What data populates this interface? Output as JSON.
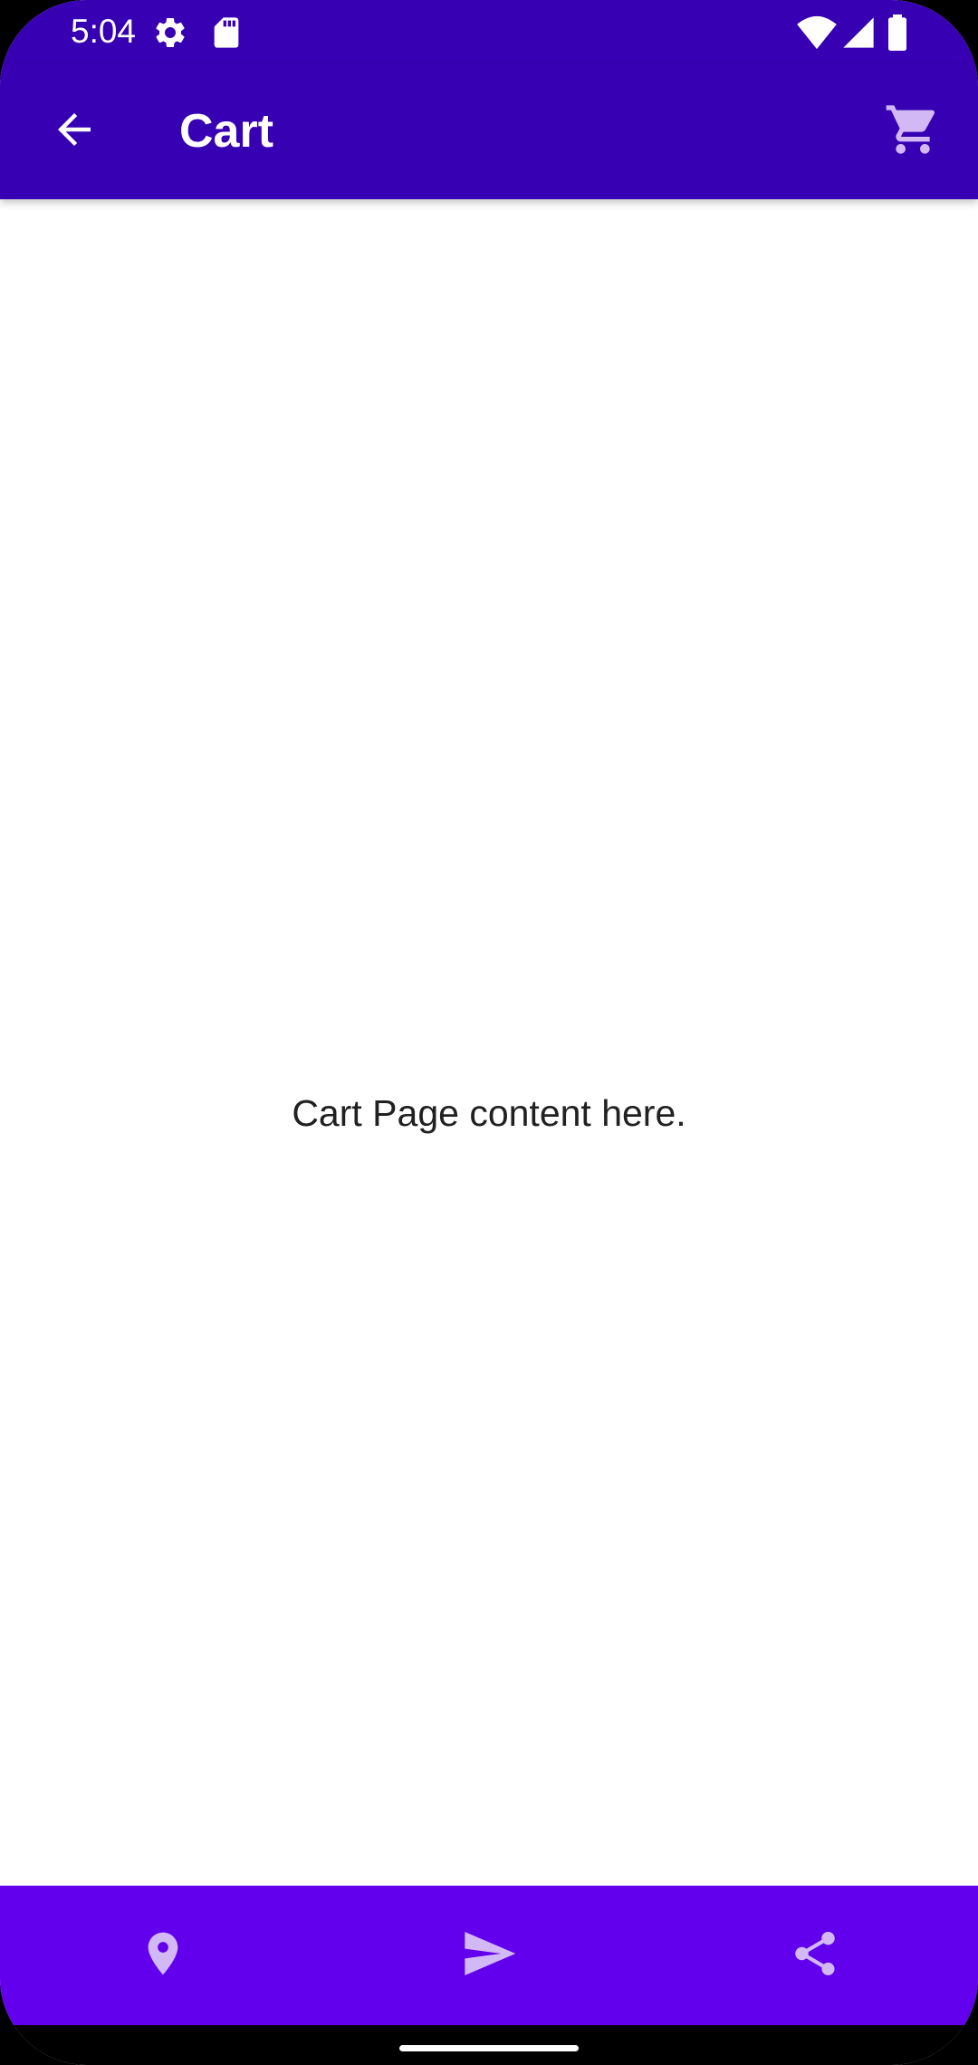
{
  "status_bar": {
    "time": "5:04",
    "left_icons": [
      "settings-icon",
      "sd-card-icon"
    ],
    "right_icons": [
      "wifi-icon",
      "cellular-signal-icon",
      "battery-icon"
    ]
  },
  "app_bar": {
    "title": "Cart",
    "nav_icon": "arrow-back-icon",
    "action_icon": "shopping-cart-icon"
  },
  "content": {
    "text": "Cart Page content here."
  },
  "bottom_nav": {
    "items": [
      {
        "icon": "location-pin-icon"
      },
      {
        "icon": "send-icon"
      },
      {
        "icon": "share-icon"
      }
    ]
  },
  "colors": {
    "primary_dark": "#3700B3",
    "primary": "#6200EE",
    "icon_tint": "#D2B9F5",
    "background": "#FFFFFF",
    "text": "#212121"
  }
}
